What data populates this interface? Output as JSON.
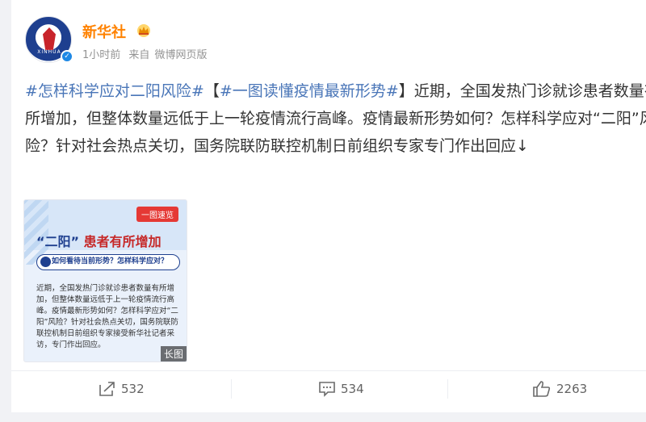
{
  "post": {
    "author": "新华社",
    "time": "1小时前",
    "source_prefix": "来自",
    "source": "微博网页版",
    "topic1": "#怎样科学应对二阳风险#",
    "bracket_open": "【",
    "topic2": "#一图读懂疫情最新形势#",
    "bracket_close": "】",
    "text": "近期，全国发热门诊就诊患者数量有所增加，但整体数量远低于上一轮疫情流行高峰。疫情最新形势如何？怎样科学应对“二阳”风险？针对社会热点关切，国务院联防联控机制日前组织专家专门作出回应↓"
  },
  "image": {
    "badge": "一图速览",
    "headline_quote": "“二阳”",
    "headline_rest": "患者有所增加",
    "question": "如何看待当前形势？怎样科学应对？",
    "paragraph": "近期，全国发热门诊就诊患者数量有所增加，但整体数量远低于上一轮疫情流行高峰。疫情最新形势如何？怎样科学应对“二阳”风险？针对社会热点关切，国务院联防联控机制日前组织专家接受新华社记者采访，专门作出回应。",
    "long_label": "长图",
    "avatar_ring": "XINHUA"
  },
  "actions": {
    "repost": "532",
    "comment": "534",
    "like": "2263"
  },
  "icons": {
    "repost": "share-arrow-icon",
    "comment": "comment-bubble-icon",
    "like": "thumbs-up-icon",
    "verified": "verified-badge-icon",
    "crown": "crown-icon"
  },
  "colors": {
    "author": "#ff8200",
    "topic": "#4a76b8",
    "verified": "#1e88e5"
  }
}
